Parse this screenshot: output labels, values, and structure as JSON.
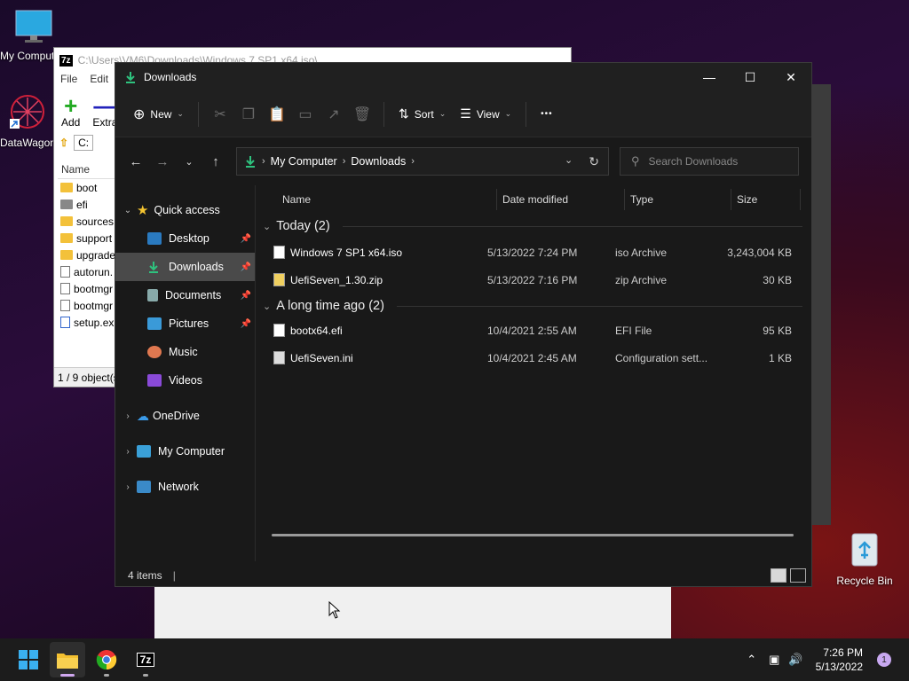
{
  "desktop": {
    "icons": [
      {
        "label": "My Computer"
      },
      {
        "label": "DataWagon"
      },
      {
        "label": "Recycle Bin"
      }
    ]
  },
  "sevenzip": {
    "title": "C:\\Users\\VM6\\Downloads\\Windows 7 SP1 x64.iso\\",
    "logo": "7z",
    "menu": [
      "File",
      "Edit"
    ],
    "add_label": "Add",
    "extract_label": "Extra",
    "addr": "C:",
    "name_header": "Name",
    "items": [
      "boot",
      "efi",
      "sources",
      "support",
      "upgrade",
      "autorun.",
      "bootmgr",
      "bootmgr",
      "setup.ex"
    ],
    "status": "1 / 9 object(s"
  },
  "explorer": {
    "title": "Downloads",
    "toolbar": {
      "new": "New",
      "sort": "Sort",
      "view": "View",
      "more": "•••"
    },
    "address": {
      "root": "My Computer",
      "current": "Downloads"
    },
    "search_placeholder": "Search Downloads",
    "sidebar": {
      "quick_access": "Quick access",
      "desktop": "Desktop",
      "downloads": "Downloads",
      "documents": "Documents",
      "pictures": "Pictures",
      "music": "Music",
      "videos": "Videos",
      "onedrive": "OneDrive",
      "mycomputer": "My Computer",
      "network": "Network"
    },
    "columns": {
      "name": "Name",
      "date": "Date modified",
      "type": "Type",
      "size": "Size"
    },
    "groups": {
      "today": "Today (2)",
      "older": "A long time ago (2)"
    },
    "files": [
      {
        "name": "Windows 7 SP1 x64.iso",
        "date": "5/13/2022 7:24 PM",
        "type": "iso Archive",
        "size": "3,243,004 KB"
      },
      {
        "name": "UefiSeven_1.30.zip",
        "date": "5/13/2022 7:16 PM",
        "type": "zip Archive",
        "size": "30 KB"
      },
      {
        "name": "bootx64.efi",
        "date": "10/4/2021 2:55 AM",
        "type": "EFI File",
        "size": "95 KB"
      },
      {
        "name": "UefiSeven.ini",
        "date": "10/4/2021 2:45 AM",
        "type": "Configuration sett...",
        "size": "1 KB"
      }
    ],
    "status": "4 items"
  },
  "taskbar": {
    "time": "7:26 PM",
    "date": "5/13/2022",
    "notifications": "1",
    "app_7z": "7z"
  }
}
